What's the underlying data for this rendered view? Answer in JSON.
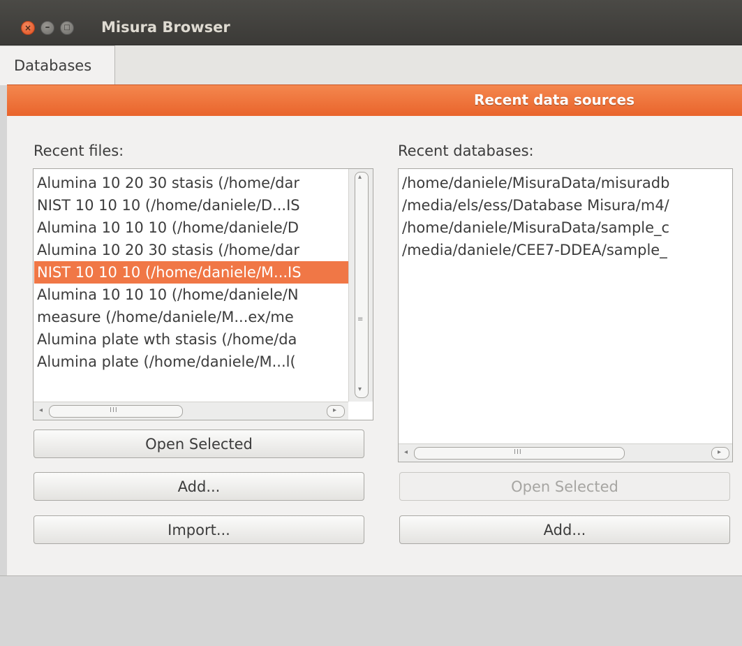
{
  "window": {
    "title": "Misura Browser",
    "close_glyph": "×",
    "minimize_glyph": "–",
    "maximize_glyph": "□"
  },
  "tabs": [
    {
      "label": "Databases",
      "active": true
    }
  ],
  "header": {
    "title": "Recent data sources",
    "color": "#f07746"
  },
  "recent_files": {
    "label": "Recent files:",
    "items": [
      "Alumina 10 20 30 stasis (/home/dar",
      "NIST 10 10 10 (/home/daniele/D...IS",
      "Alumina 10 10 10 (/home/daniele/D",
      "Alumina 10 20 30 stasis (/home/dar",
      "NIST 10 10 10 (/home/daniele/M...IS",
      "Alumina 10 10 10 (/home/daniele/N",
      "measure (/home/daniele/M...ex/me",
      "Alumina plate wth stasis (/home/da",
      "Alumina plate (/home/daniele/M...l("
    ],
    "selected_index": 4,
    "buttons": {
      "open": "Open Selected",
      "add": "Add...",
      "import": "Import..."
    }
  },
  "recent_databases": {
    "label": "Recent databases:",
    "items": [
      "/home/daniele/MisuraData/misuradb",
      "/media/els/ess/Database Misura/m4/",
      "/home/daniele/MisuraData/sample_c",
      "/media/daniele/CEE7-DDEA/sample_"
    ],
    "buttons": {
      "open": "Open Selected",
      "open_disabled": true,
      "add": "Add..."
    }
  },
  "scroll": {
    "arrow_up": "▴",
    "arrow_down": "▾",
    "arrow_left": "◂",
    "arrow_right": "▸",
    "grip_h": "III",
    "grip_v": "≡"
  }
}
